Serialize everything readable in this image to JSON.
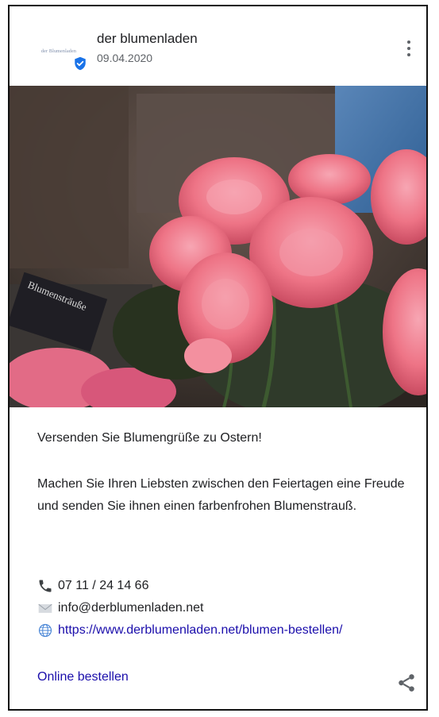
{
  "post": {
    "author": "der blumenladen",
    "date": "09.04.2020",
    "logo_text": "der Blumenladen",
    "headline": "Versenden Sie Blumengrüße zu Ostern!",
    "body": "Machen Sie Ihren Liebsten zwischen den Feiertagen eine Freude und senden Sie ihnen einen farbenfrohen Blumenstrauß.",
    "phone": "07 11 / 24 14 66",
    "email": "info@derblumenladen.net",
    "website": "https://www.derblumenladen.net/blumen-bestellen/",
    "cta": "Online bestellen"
  },
  "icons": {
    "verified": "verified-badge-icon",
    "more": "more-vert-icon",
    "phone": "phone-icon",
    "email": "mail-icon",
    "web": "globe-icon",
    "share": "share-icon"
  },
  "colors": {
    "link": "#1a0dab",
    "verified": "#1a73e8",
    "peony": "#f07a8c"
  }
}
